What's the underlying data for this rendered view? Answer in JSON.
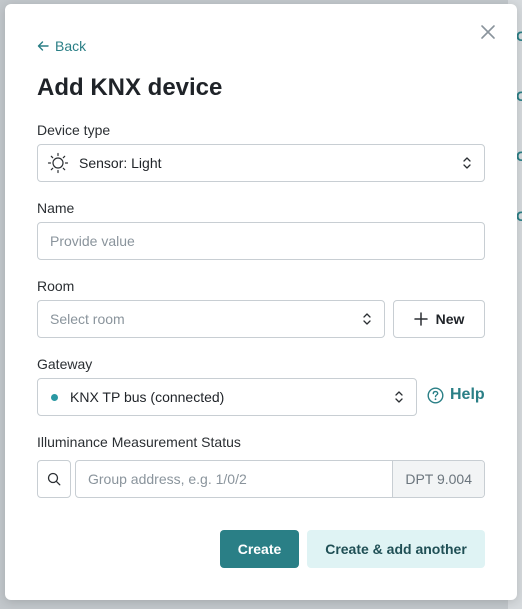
{
  "background": {
    "side_letters": [
      "C",
      "C",
      "C",
      "C"
    ]
  },
  "modal": {
    "back_label": "Back",
    "title": "Add KNX device",
    "device_type": {
      "label": "Device type",
      "value": "Sensor: Light"
    },
    "name": {
      "label": "Name",
      "placeholder": "Provide value"
    },
    "room": {
      "label": "Room",
      "placeholder": "Select room",
      "new_label": "New"
    },
    "gateway": {
      "label": "Gateway",
      "value": "KNX TP bus (connected)",
      "help_label": "Help"
    },
    "illuminance": {
      "label": "Illuminance Measurement Status",
      "placeholder": "Group address, e.g. 1/0/2",
      "dpt": "DPT 9.004"
    },
    "buttons": {
      "create": "Create",
      "create_another": "Create & add another"
    }
  },
  "colors": {
    "accent": "#2a7f86",
    "accent_light": "#dff3f4",
    "status_dot": "#2a98a3"
  }
}
